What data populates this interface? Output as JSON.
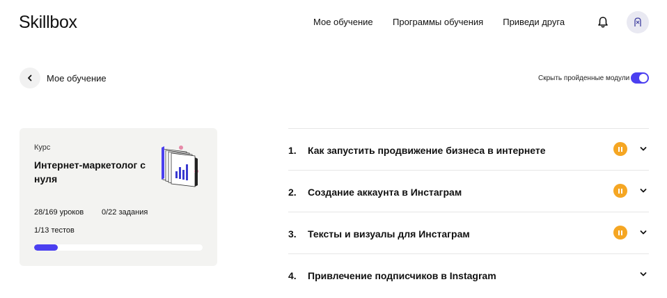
{
  "header": {
    "logo": "Skillbox",
    "nav": [
      "Мое обучение",
      "Программы обучения",
      "Приведи друга"
    ],
    "bell_icon": "bell-icon",
    "avatar_icon": "avatar-icon"
  },
  "subheader": {
    "back_label": "Мое обучение",
    "toggle_label": "Скрыть пройденные модули",
    "toggle_on": true
  },
  "course": {
    "type": "Курс",
    "title": "Интернет-маркетолог с нуля",
    "lessons": "28/169 уроков",
    "tasks": "0/22 задания",
    "tests": "1/13 тестов",
    "progress_fraction": 0.14
  },
  "modules": [
    {
      "number": "1.",
      "title": "Как запустить продвижение бизнеса в интернете",
      "in_progress": true
    },
    {
      "number": "2.",
      "title": "Создание аккаунта в Инстаграм",
      "in_progress": true
    },
    {
      "number": "3.",
      "title": "Тексты и визуалы для Инстаграм",
      "in_progress": true
    },
    {
      "number": "4.",
      "title": "Привлечение подписчиков в Instagram",
      "in_progress": false
    }
  ],
  "colors": {
    "accent": "#4b3ff0",
    "status_in_progress": "#f5a623",
    "card_bg": "#f3f3f1"
  }
}
